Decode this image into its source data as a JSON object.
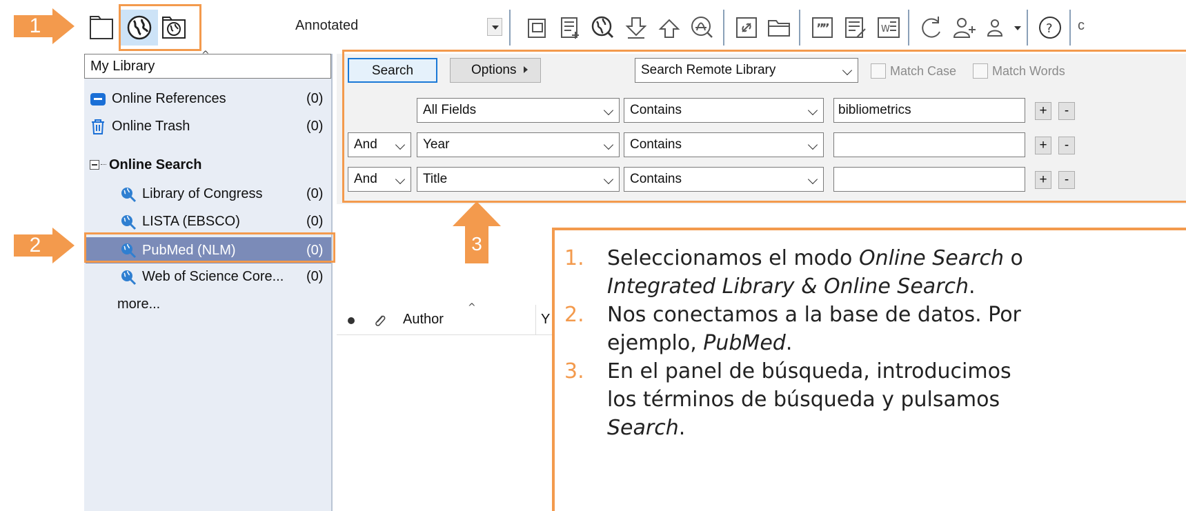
{
  "toolbar": {
    "mode_label": "Annotated",
    "help_truncated": "c"
  },
  "steps": {
    "one": "1",
    "two": "2",
    "three": "3"
  },
  "library_pane": {
    "header": "My Library",
    "items": [
      {
        "label": "Online References",
        "count": "(0)"
      },
      {
        "label": "Online Trash",
        "count": "(0)"
      }
    ],
    "group_label": "Online Search",
    "connections": [
      {
        "label": "Library of Congress",
        "count": "(0)"
      },
      {
        "label": "LISTA (EBSCO)",
        "count": "(0)"
      },
      {
        "label": "PubMed (NLM)",
        "count": "(0)",
        "selected": true
      },
      {
        "label": "Web of Science Core...",
        "count": "(0)"
      }
    ],
    "more": "more..."
  },
  "search_panel": {
    "search_button": "Search",
    "options_button": "Options",
    "scope": "Search Remote Library",
    "match_case": "Match Case",
    "match_words": "Match Words",
    "rows": [
      {
        "operator": "",
        "field": "All Fields",
        "condition": "Contains",
        "value": "bibliometrics"
      },
      {
        "operator": "And",
        "field": "Year",
        "condition": "Contains",
        "value": ""
      },
      {
        "operator": "And",
        "field": "Title",
        "condition": "Contains",
        "value": ""
      }
    ],
    "plus": "+",
    "minus": "-"
  },
  "results": {
    "author_col": "Author",
    "year_col": "Y"
  },
  "callout": {
    "n1": "1.",
    "l1a": "Seleccionamos el modo ",
    "l1b": "Online Search",
    "l1c": " o",
    "l1d": "Integrated Library & Online Search",
    "l1e": ".",
    "n2": "2.",
    "l2a": "Nos conectamos a la base de datos. Por",
    "l2b": "ejemplo, ",
    "l2c": "PubMed",
    "l2d": ".",
    "n3": "3.",
    "l3a": "En el panel de búsqueda, introducimos",
    "l3b": "los términos de búsqueda y pulsamos",
    "l3c": "Search",
    "l3d": "."
  },
  "colors": {
    "accent_orange": "#f39a4d",
    "selection": "#7b8bb8",
    "pane_bg": "#e8edf5"
  }
}
